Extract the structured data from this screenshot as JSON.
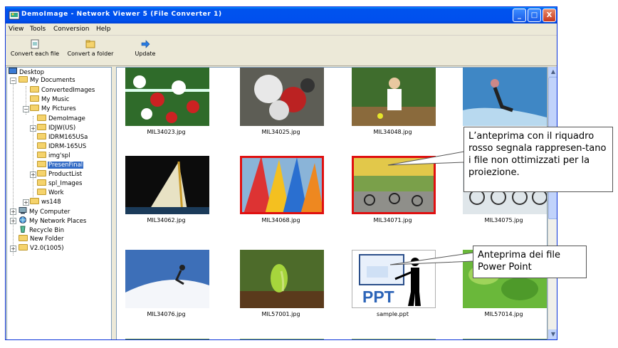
{
  "window": {
    "title": "DemoImage - Network Viewer 5 (File Converter 1)",
    "controls": {
      "minimize": "_",
      "maximize": "□",
      "close": "X"
    }
  },
  "menu": [
    "View",
    "Tools",
    "Conversion",
    "Help"
  ],
  "toolbar": {
    "convert_each_file": "Convert each file",
    "convert_folder": "Convert a folder",
    "update": "Update"
  },
  "tree": {
    "desktop": "Desktop",
    "my_documents": "My Documents",
    "converted_images": "ConvertedImages",
    "my_music": "My Music",
    "my_pictures": "My Pictures",
    "demoimage": "DemoImage",
    "idjw": "IDJW(US)",
    "idrm165usa": "IDRM165USa",
    "idrm_165us": "IDRM-165US",
    "imgspl": "img'spl",
    "presenfinal": "PresenFinal",
    "productlist": "ProductList",
    "spl_images": "spl_Images",
    "work": "Work",
    "ws148": "ws148",
    "my_computer": "My Computer",
    "my_network_places": "My Network Places",
    "recycle_bin": "Recycle Bin",
    "new_folder": "New Folder",
    "v2": "V2.0(1005)"
  },
  "thumbnails": [
    "MIL34023.jpg",
    "MIL34025.jpg",
    "MIL34048.jpg",
    "",
    "MIL34062.jpg",
    "MIL34068.jpg",
    "MIL34071.jpg",
    "MIL34075.jpg",
    "MIL34076.jpg",
    "MIL57001.jpg",
    "sample.ppt",
    "MIL57014.jpg"
  ],
  "ppt_label": "PPT",
  "callouts": {
    "red_frame": "L’anteprima con il riquadro rosso segnala rappresen-tano i file non ottimizzati per la proiezione.",
    "powerpoint": "Anteprima dei file Power Point"
  },
  "colors": {
    "titlebar": "#0054e3",
    "flag_frame": "#e01010",
    "selection": "#316ac5"
  }
}
